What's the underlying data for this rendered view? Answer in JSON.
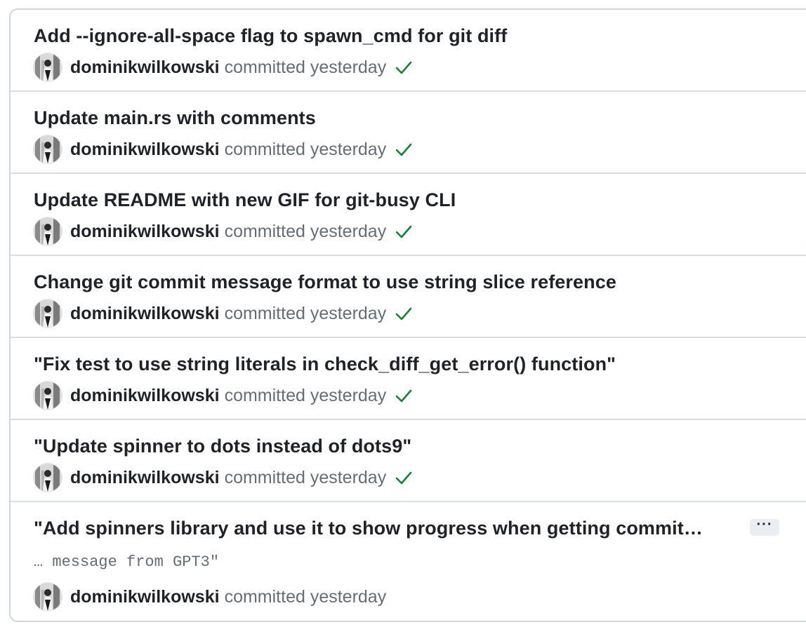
{
  "commits": [
    {
      "title": "Add --ignore-all-space flag to spawn_cmd for git diff",
      "author": "dominikwilkowski",
      "time_text": "committed yesterday",
      "status": "success"
    },
    {
      "title": "Update main.rs with comments",
      "author": "dominikwilkowski",
      "time_text": "committed yesterday",
      "status": "success"
    },
    {
      "title": "Update README with new GIF for git-busy CLI",
      "author": "dominikwilkowski",
      "time_text": "committed yesterday",
      "status": "success"
    },
    {
      "title": "Change git commit message format to use string slice reference",
      "author": "dominikwilkowski",
      "time_text": "committed yesterday",
      "status": "success"
    },
    {
      "title": "\"Fix test to use string literals in check_diff_get_error() function\"",
      "author": "dominikwilkowski",
      "time_text": "committed yesterday",
      "status": "success"
    },
    {
      "title": "\"Update spinner to dots instead of dots9\"",
      "author": "dominikwilkowski",
      "time_text": "committed yesterday",
      "status": "success"
    },
    {
      "title": "\"Add spinners library and use it to show progress when getting commit…",
      "body": "… message from GPT3\"",
      "ellipsis": "···",
      "author": "dominikwilkowski",
      "time_text": "committed yesterday"
    }
  ],
  "icons": {
    "check": "check-icon",
    "avatar": "avatar"
  },
  "colors": {
    "check_green": "#1a7f37",
    "text_primary": "#1f2328",
    "text_muted": "#656d76",
    "border": "#d0d7de"
  }
}
